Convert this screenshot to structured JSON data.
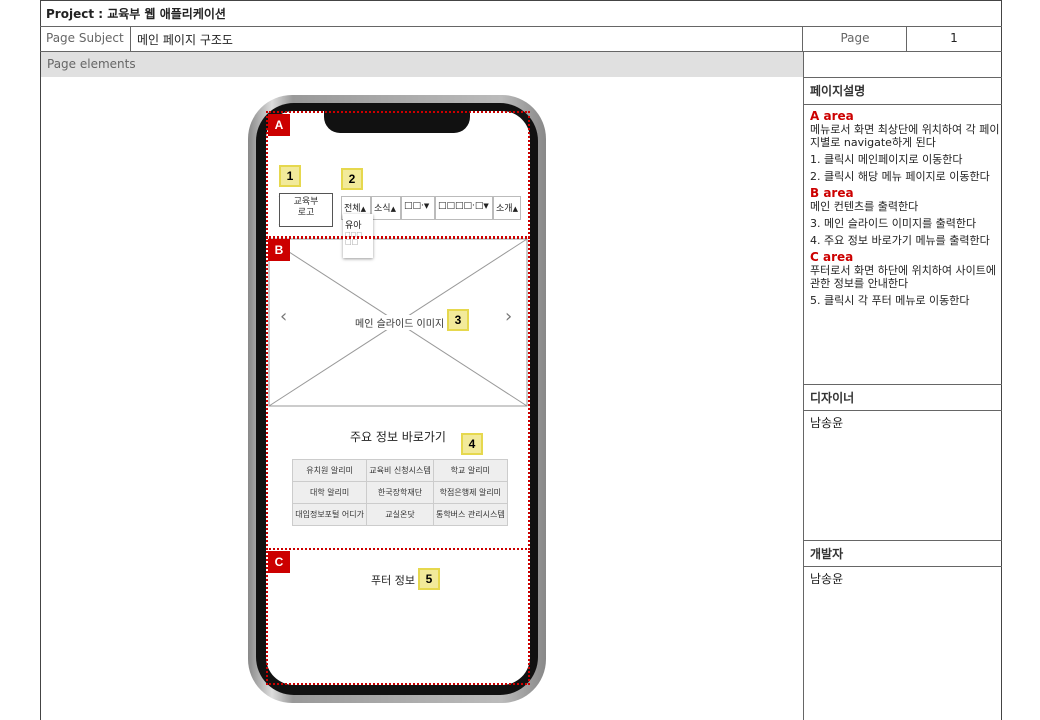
{
  "project_title": "Project : 교육부 웹 애플리케이션",
  "page_subject_label": "Page Subject",
  "page_subject_value": "메인 페이지 구조도",
  "page_label": "Page",
  "page_number": "1",
  "page_elements_label": "Page elements",
  "sidebar": {
    "desc_heading": "페이지설명",
    "designer_heading": "디자이너",
    "designer_name": "남송윤",
    "developer_heading": "개발자",
    "developer_name": "남송윤",
    "a_title": "A area",
    "a_desc": "메뉴로서 화면 최상단에 위치하여 각 페이지별로 navigate하게 된다",
    "a_item1": "1.  클릭시 메인페이지로 이동한다",
    "a_item2": "2. 클릭시 해당 메뉴 페이지로 이동한다",
    "b_title": "B area",
    "b_desc": "메인 컨텐츠를 출력한다",
    "b_item3": "3. 메인 슬라이드 이미지를 출력한다",
    "b_item4": "4. 주요 정보 바로가기 메뉴를 출력한다",
    "c_title": "C area",
    "c_desc": "푸터로서 화면 하단에 위치하여 사이트에 관한 정보를 안내한다",
    "c_item5": "5.  클릭시 각 푸터 메뉴로 이동한다"
  },
  "mockup": {
    "area_a": "A",
    "area_b": "B",
    "area_c": "C",
    "n1": "1",
    "n2": "2",
    "n3": "3",
    "n4": "4",
    "n5": "5",
    "logo_line1": "교육부",
    "logo_line2": "로고",
    "menus": [
      "전체",
      "소식",
      "□□·",
      "□□□□·□",
      "소개"
    ],
    "dropdown": [
      "유아",
      "□□□",
      "□□"
    ],
    "slider_label": "메인 슬라이드 이미지",
    "prev_arrow": "‹",
    "next_arrow": "›",
    "quick_title": "주요 정보 바로가기",
    "quick_links": [
      [
        "유치원 알리미",
        "교육비 신청시스템",
        "학교 알리미"
      ],
      [
        "대학 알리미",
        "한국장학재단",
        "학점은행제 알리미"
      ],
      [
        "대입정보포털 어디가",
        "교실온닷",
        "통학버스 관리시스템"
      ]
    ],
    "footer_label": "푸터 정보"
  }
}
